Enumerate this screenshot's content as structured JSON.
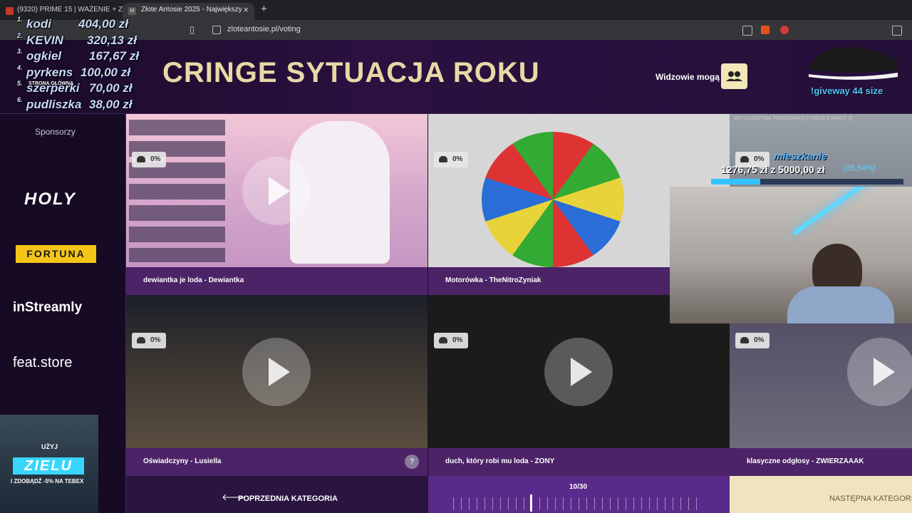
{
  "browser": {
    "tabs": [
      {
        "title": "(9320) PRIME 15 | WAŻENIE + ZA"
      },
      {
        "title": "Złote Antosie 2025 - Największy"
      }
    ],
    "new_tab_label": "+",
    "close_label": "×",
    "url": "zloteantosie.pl/voting"
  },
  "header": {
    "category_title": "CRINGE SYTUACJA ROKU",
    "viewers_label": "Widzowie mogą"
  },
  "sidebar": {
    "sponsors_title": "Sponsorzy",
    "sponsors": [
      "HOLY",
      "FORTUNA",
      "inStreamly",
      "feat.store"
    ]
  },
  "cards": [
    {
      "title": "dewiantka je loda - Dewiantka",
      "percent": "0%"
    },
    {
      "title": "Motorówka - TheNitroZyniak",
      "percent": "0%"
    },
    {
      "title": "",
      "percent": "0%"
    },
    {
      "title": "Oświadczyny - Lusiella",
      "percent": "0%",
      "help": "?"
    },
    {
      "title": "duch, który robi mu loda - ZONY",
      "percent": "0%"
    },
    {
      "title": "klasyczne odgłosy - ZWIERZAAAK",
      "percent": "0%"
    }
  ],
  "nav": {
    "prev_label": "POPRZEDNIA KATEGORIA",
    "progress_label": "10/30",
    "progress": 0.333,
    "next_label": "NASTĘPNA KATEGORIA"
  },
  "overlay": {
    "donations": [
      {
        "rank": "1.",
        "name": "kodi",
        "amount": "404,00 zł"
      },
      {
        "rank": "2.",
        "name": "KEVIN",
        "amount": "320,13 zł"
      },
      {
        "rank": "3.",
        "name": "ogkiel",
        "amount": "167,67 zł"
      },
      {
        "rank": "4.",
        "name": "pyrkens",
        "amount": "100,00 zł"
      },
      {
        "rank": "5.",
        "name": "szerperki",
        "amount": "70,00 zł"
      },
      {
        "rank": "6.",
        "name": "pudliszka",
        "amount": "38,00 zł"
      }
    ],
    "strona_label": "STRONA GŁÓWNA",
    "giveaway": "!giveway 44 size",
    "goal_title": "WY UCZESTNIK PROGRAMU!! (TWOJE 6 MINUT 3)",
    "goal_name": "mieszkanie",
    "goal_amount": "1276,75 zł z 5000,00 zł",
    "goal_percent": "(25,54%)",
    "goal_fraction": 0.2554,
    "promo_uzyj": "UŻYJ",
    "promo_code": "ZIELU",
    "promo_sub": "I ZDOBĄDŹ -5% NA TEBEX"
  }
}
